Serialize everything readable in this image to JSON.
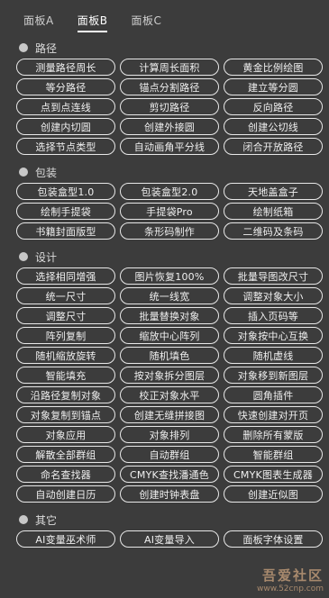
{
  "tabs": [
    {
      "label": "面板A",
      "active": false
    },
    {
      "label": "面板B",
      "active": true
    },
    {
      "label": "面板C",
      "active": false
    }
  ],
  "sections": [
    {
      "title": "路径",
      "buttons": [
        "测量路径周长",
        "计算周长面积",
        "黄金比例绘图",
        "等分路径",
        "锚点分割路径",
        "建立等分圆",
        "点到点连线",
        "剪切路径",
        "反向路径",
        "创建内切圆",
        "创建外接圆",
        "创建公切线",
        "选择节点类型",
        "自动画角平分线",
        "闭合开放路径"
      ]
    },
    {
      "title": "包装",
      "buttons": [
        "包装盒型1.0",
        "包装盒型2.0",
        "天地盖盒子",
        "绘制手提袋",
        "手提袋Pro",
        "绘制纸箱",
        "书籍封面版型",
        "条形码制作",
        "二维码及条码"
      ]
    },
    {
      "title": "设计",
      "buttons": [
        "选择相同增强",
        "图片恢复100%",
        "批量导图改尺寸",
        "统一尺寸",
        "统一线宽",
        "调整对象大小",
        "调整尺寸",
        "批量替换对象",
        "插入页码等",
        "阵列复制",
        "缩放中心阵列",
        "对象按中心互换",
        "随机缩放旋转",
        "随机填色",
        "随机虚线",
        "智能填充",
        "按对象拆分图层",
        "对象移到新图层",
        "沿路径复制对象",
        "校正对象水平",
        "圆角插件",
        "对象复制到锚点",
        "创建无缝拼接图",
        "快速创建对开页",
        "对象应用",
        "对象排列",
        "删除所有蒙版",
        "解散全部群组",
        "自动群组",
        "智能群组",
        "命名查找器",
        "CMYK查找潘通色",
        "CMYK图表生成器",
        "自动创建日历",
        "创建时钟表盘",
        "创建近似图"
      ]
    },
    {
      "title": "其它",
      "buttons": [
        "AI变量巫术师",
        "AI变量导入",
        "面板字体设置"
      ]
    }
  ],
  "watermark": {
    "main": "吾爱社区",
    "sub": "www.52cnp.com"
  }
}
